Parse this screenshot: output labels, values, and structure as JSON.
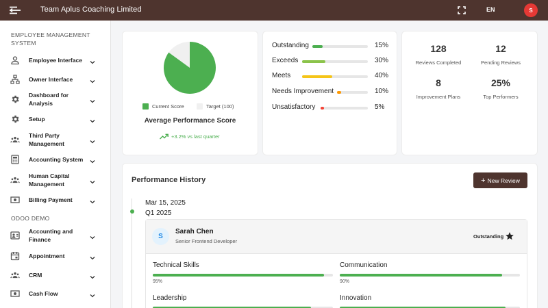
{
  "topbar": {
    "title": "Team Aplus Coaching Limited",
    "language": "EN",
    "avatar_initial": "S",
    "brand_color": "#4e342e",
    "avatar_color": "#e53935"
  },
  "sidebar": {
    "section1": "EMPLOYEE MANAGEMENT SYSTEM",
    "items1": [
      {
        "label": "Employee Interface",
        "icon": "person-icon"
      },
      {
        "label": "Owner Interface",
        "icon": "org-chart-icon"
      },
      {
        "label": "Dashboard for Analysis",
        "icon": "gear-icon"
      },
      {
        "label": "Setup",
        "icon": "gear-icon"
      },
      {
        "label": "Third Party Management",
        "icon": "group-icon"
      },
      {
        "label": "Accounting System",
        "icon": "calculator-icon"
      },
      {
        "label": "Human Capital Management",
        "icon": "group-icon"
      },
      {
        "label": "Billing Payment",
        "icon": "money-icon"
      }
    ],
    "section2": "ODOO DEMO",
    "items2": [
      {
        "label": "Accounting and Finance",
        "icon": "contacts-icon"
      },
      {
        "label": "Appointment",
        "icon": "calendar-icon"
      },
      {
        "label": "CRM",
        "icon": "group-icon"
      },
      {
        "label": "Cash Flow",
        "icon": "money-icon"
      }
    ]
  },
  "score_card": {
    "legend_current": "Current Score",
    "legend_target": "Target (100)",
    "title": "Average Performance Score",
    "trend": "+3.2% vs last quarter",
    "current_fraction": 0.85,
    "current_color": "#4caf50",
    "target_color": "#f0f0f0"
  },
  "distribution": [
    {
      "label": "Outstanding",
      "percent": "15%",
      "value": 15,
      "color": "#4caf50"
    },
    {
      "label": "Exceeds",
      "percent": "30%",
      "value": 30,
      "color": "#8bc34a"
    },
    {
      "label": "Meets",
      "percent": "40%",
      "value": 40,
      "color": "#f5c518"
    },
    {
      "label": "Needs Improvement",
      "percent": "10%",
      "value": 10,
      "color": "#ff9800"
    },
    {
      "label": "Unsatisfactory",
      "percent": "5%",
      "value": 5,
      "color": "#f44336"
    }
  ],
  "stats": [
    {
      "value": "128",
      "label": "Reviews Completed"
    },
    {
      "value": "12",
      "label": "Pending Reviews"
    },
    {
      "value": "8",
      "label": "Improvement Plans"
    },
    {
      "value": "25%",
      "label": "Top Performers"
    }
  ],
  "history": {
    "title": "Performance History",
    "new_review_label": "New Review",
    "entry": {
      "date": "Mar 15, 2025",
      "quarter": "Q1 2025",
      "initial": "S",
      "name": "Sarah Chen",
      "role": "Senior Frontend Developer",
      "rating": "Outstanding",
      "skills": [
        {
          "name": "Technical Skills",
          "percent": "95%",
          "value": 95
        },
        {
          "name": "Communication",
          "percent": "90%",
          "value": 90
        },
        {
          "name": "Leadership",
          "percent": "",
          "value": 88
        },
        {
          "name": "Innovation",
          "percent": "",
          "value": 92
        }
      ]
    }
  }
}
